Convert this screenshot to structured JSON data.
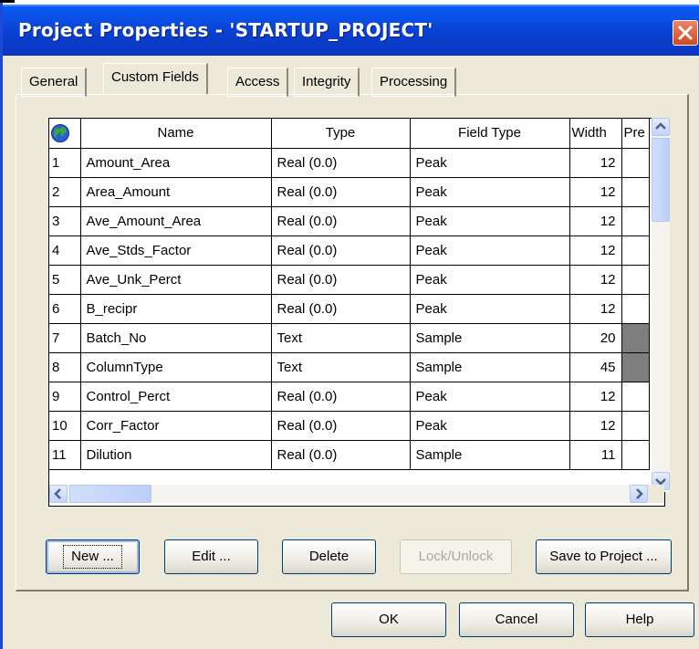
{
  "window": {
    "title": "Project Properties - 'STARTUP_PROJECT'"
  },
  "tabs": [
    {
      "label": "General",
      "active": false
    },
    {
      "label": "Custom Fields",
      "active": true
    },
    {
      "label": "Access",
      "active": false
    },
    {
      "label": "Integrity",
      "active": false
    },
    {
      "label": "Processing",
      "active": false
    }
  ],
  "grid": {
    "columns": [
      "Name",
      "Type",
      "Field Type",
      "Width",
      "Pre"
    ],
    "rows": [
      {
        "num": "1",
        "name": "Amount_Area",
        "type": "Real (0.0)",
        "field_type": "Peak",
        "width": "12",
        "pre_shaded": false
      },
      {
        "num": "2",
        "name": "Area_Amount",
        "type": "Real (0.0)",
        "field_type": "Peak",
        "width": "12",
        "pre_shaded": false
      },
      {
        "num": "3",
        "name": "Ave_Amount_Area",
        "type": "Real (0.0)",
        "field_type": "Peak",
        "width": "12",
        "pre_shaded": false
      },
      {
        "num": "4",
        "name": "Ave_Stds_Factor",
        "type": "Real (0.0)",
        "field_type": "Peak",
        "width": "12",
        "pre_shaded": false
      },
      {
        "num": "5",
        "name": "Ave_Unk_Perct",
        "type": "Real (0.0)",
        "field_type": "Peak",
        "width": "12",
        "pre_shaded": false
      },
      {
        "num": "6",
        "name": "B_recipr",
        "type": "Real (0.0)",
        "field_type": "Peak",
        "width": "12",
        "pre_shaded": false
      },
      {
        "num": "7",
        "name": "Batch_No",
        "type": "Text",
        "field_type": "Sample",
        "width": "20",
        "pre_shaded": true
      },
      {
        "num": "8",
        "name": "ColumnType",
        "type": "Text",
        "field_type": "Sample",
        "width": "45",
        "pre_shaded": true
      },
      {
        "num": "9",
        "name": "Control_Perct",
        "type": "Real (0.0)",
        "field_type": "Peak",
        "width": "12",
        "pre_shaded": false
      },
      {
        "num": "10",
        "name": "Corr_Factor",
        "type": "Real (0.0)",
        "field_type": "Peak",
        "width": "12",
        "pre_shaded": false
      },
      {
        "num": "11",
        "name": "Dilution",
        "type": "Real (0.0)",
        "field_type": "Sample",
        "width": "11",
        "pre_shaded": false
      }
    ]
  },
  "actions": {
    "new": "New ...",
    "edit": "Edit ...",
    "delete": "Delete",
    "lock_unlock": "Lock/Unlock",
    "save_to_project": "Save to Project ..."
  },
  "footer": {
    "ok": "OK",
    "cancel": "Cancel",
    "help": "Help"
  },
  "colors": {
    "titlebar": "#0a46d8",
    "dialog_bg": "#ece9d8",
    "shaded_cell": "#7e7e7e"
  },
  "icons": {
    "grid_corner": "globe-icon",
    "close": "close-icon"
  }
}
